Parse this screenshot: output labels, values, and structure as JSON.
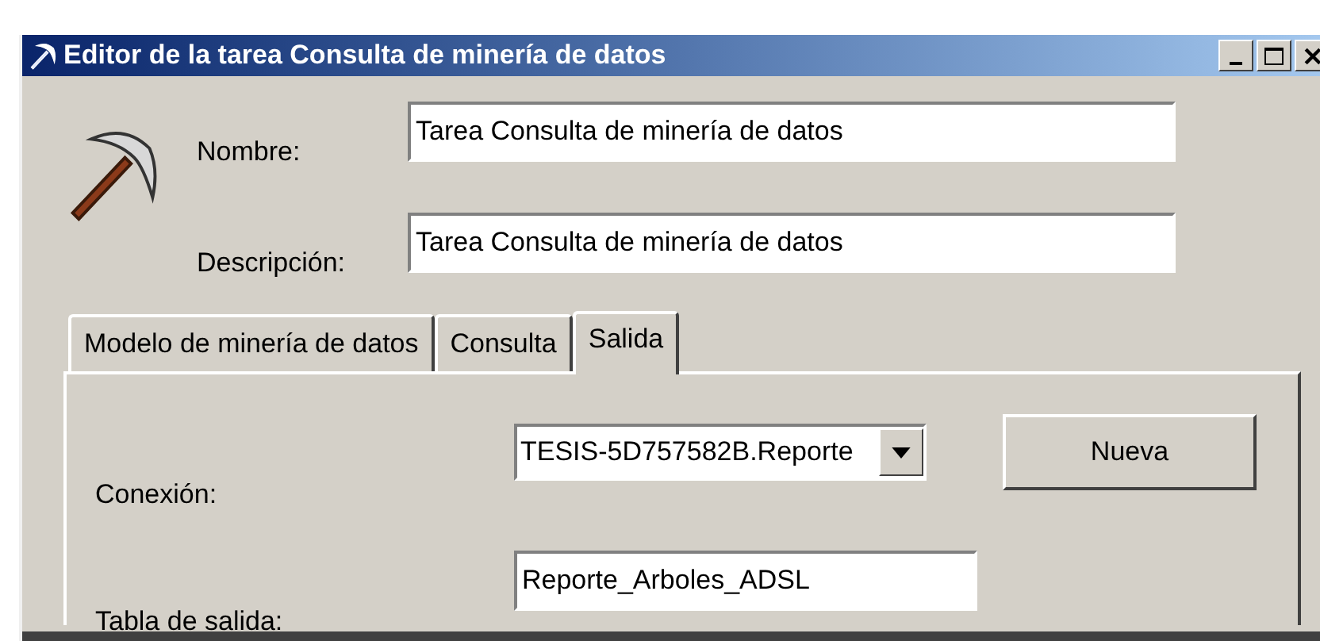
{
  "window": {
    "title": "Editor de la tarea Consulta de minería de datos"
  },
  "fields": [
    {
      "label": "Nombre:",
      "value": "Tarea Consulta de minería de datos"
    },
    {
      "label": "Descripción:",
      "value": "Tarea Consulta de minería de datos"
    }
  ],
  "tabs": [
    {
      "label": "Modelo de minería de datos",
      "selected": false
    },
    {
      "label": "Consulta",
      "selected": false
    },
    {
      "label": "Salida",
      "selected": true
    }
  ],
  "output": {
    "connection_label": "Conexión:",
    "connection_value": "TESIS-5D757582B.Reporte",
    "new_button": "Nueva",
    "table_label": "Tabla de salida:",
    "table_value": "Reporte_Arboles_ADSL"
  }
}
